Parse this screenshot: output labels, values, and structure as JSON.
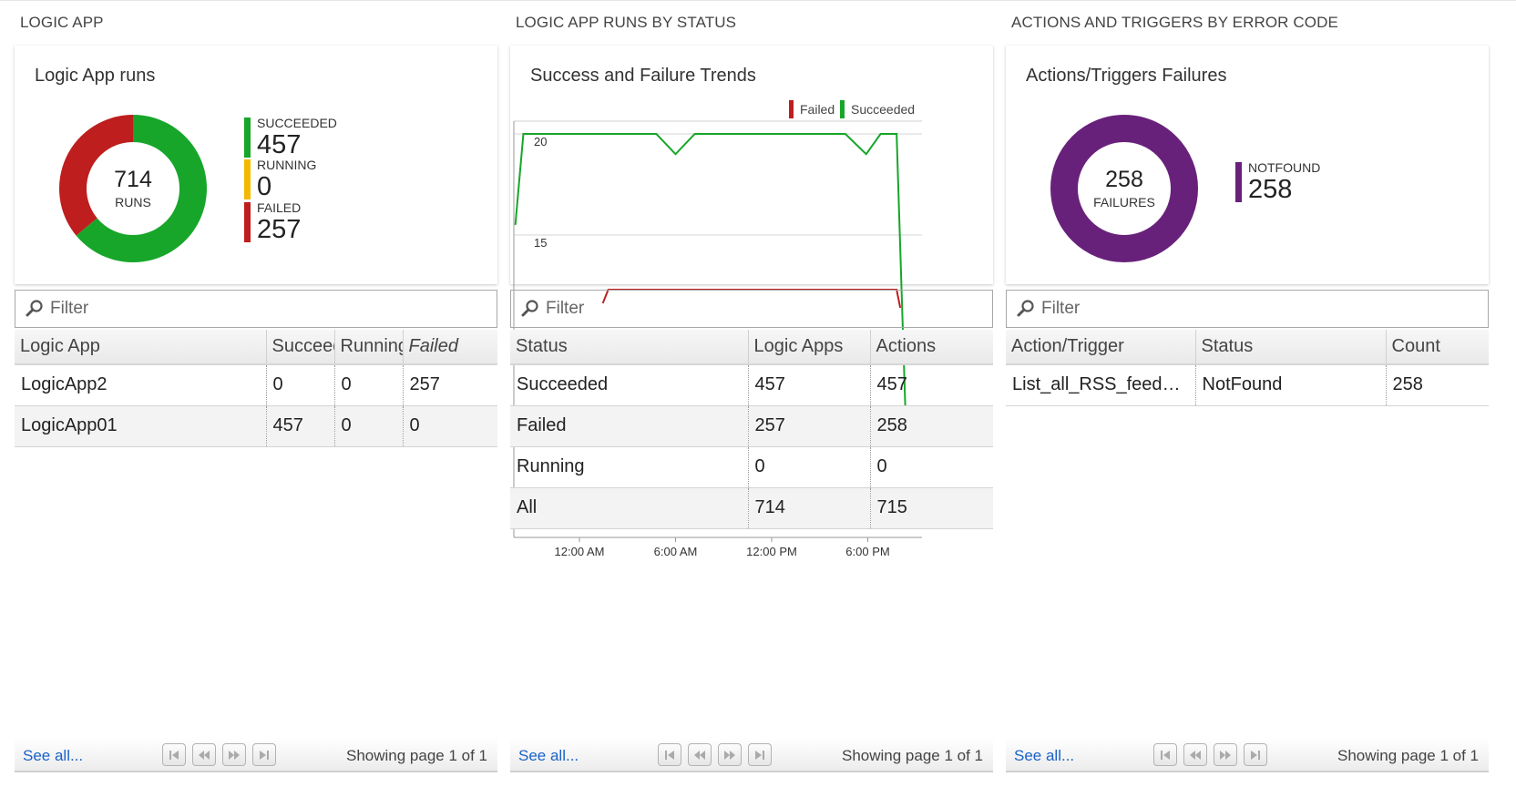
{
  "sections": [
    {
      "title": "LOGIC APP",
      "tile": {
        "title": "Logic App runs",
        "donut": {
          "total": "714",
          "total_label": "RUNS"
        },
        "legend": [
          {
            "label": "SUCCEEDED",
            "value": "457",
            "color": "#17a62a"
          },
          {
            "label": "RUNNING",
            "value": "0",
            "color": "#f5b800"
          },
          {
            "label": "FAILED",
            "value": "257",
            "color": "#be1e1e"
          }
        ]
      },
      "filter_placeholder": "Filter",
      "table": {
        "columns": [
          "Logic App",
          "Succeeded",
          "Running",
          "Failed"
        ],
        "rows": [
          [
            "LogicApp2",
            "0",
            "0",
            "257"
          ],
          [
            "LogicApp01",
            "457",
            "0",
            "0"
          ]
        ]
      },
      "footer": {
        "see_all": "See all...",
        "page_info": "Showing page 1 of 1"
      }
    },
    {
      "title": "LOGIC APP RUNS BY STATUS",
      "tile": {
        "title": "Success and Failure Trends"
      },
      "filter_placeholder": "Filter",
      "table": {
        "columns": [
          "Status",
          "Logic Apps",
          "Actions"
        ],
        "rows": [
          [
            "Succeeded",
            "457",
            "457"
          ],
          [
            "Failed",
            "257",
            "258"
          ],
          [
            "Running",
            "0",
            "0"
          ],
          [
            "All",
            "714",
            "715"
          ]
        ]
      },
      "footer": {
        "see_all": "See all...",
        "page_info": "Showing page 1 of 1"
      }
    },
    {
      "title": "ACTIONS AND TRIGGERS BY ERROR CODE",
      "tile": {
        "title": "Actions/Triggers Failures",
        "donut": {
          "total": "258",
          "total_label": "FAILURES"
        },
        "legend": [
          {
            "label": "NOTFOUND",
            "value": "258",
            "color": "#68217a"
          }
        ]
      },
      "filter_placeholder": "Filter",
      "table": {
        "columns": [
          "Action/Trigger",
          "Status",
          "Count"
        ],
        "rows": [
          [
            "List_all_RSS_feed_items",
            "NotFound",
            "258"
          ]
        ]
      },
      "footer": {
        "see_all": "See all...",
        "page_info": "Showing page 1 of 1"
      }
    }
  ],
  "chart_data": [
    {
      "type": "pie",
      "title": "Logic App runs",
      "categories": [
        "SUCCEEDED",
        "RUNNING",
        "FAILED"
      ],
      "values": [
        457,
        0,
        257
      ],
      "colors": [
        "#17a62a",
        "#f5b800",
        "#be1e1e"
      ]
    },
    {
      "type": "line",
      "title": "Success and Failure Trends",
      "x_ticks": [
        "12:00 AM",
        "6:00 AM",
        "12:00 PM",
        "6:00 PM"
      ],
      "y_ticks": [
        "20",
        "15"
      ],
      "x_hours": [
        -4,
        -3.5,
        4.8,
        6,
        7.2,
        16.6,
        17.9,
        18.8,
        19.8,
        20.4
      ],
      "series": [
        {
          "name": "Failed",
          "color": "#be1e1e",
          "values": [
            null,
            null,
            null,
            null,
            null,
            null,
            null,
            null,
            null,
            null
          ],
          "segment_hours": [
            [
              1.8,
              19.8
            ]
          ],
          "segment_value": 12.3
        },
        {
          "name": "Succeeded",
          "color": "#17a62a",
          "values": [
            15.5,
            20,
            20,
            19,
            20,
            20,
            19,
            20,
            20,
            5
          ]
        }
      ],
      "legend_position": "top-right",
      "grid": true
    },
    {
      "type": "pie",
      "title": "Actions/Triggers Failures",
      "categories": [
        "NOTFOUND"
      ],
      "values": [
        258
      ],
      "colors": [
        "#68217a"
      ]
    }
  ]
}
